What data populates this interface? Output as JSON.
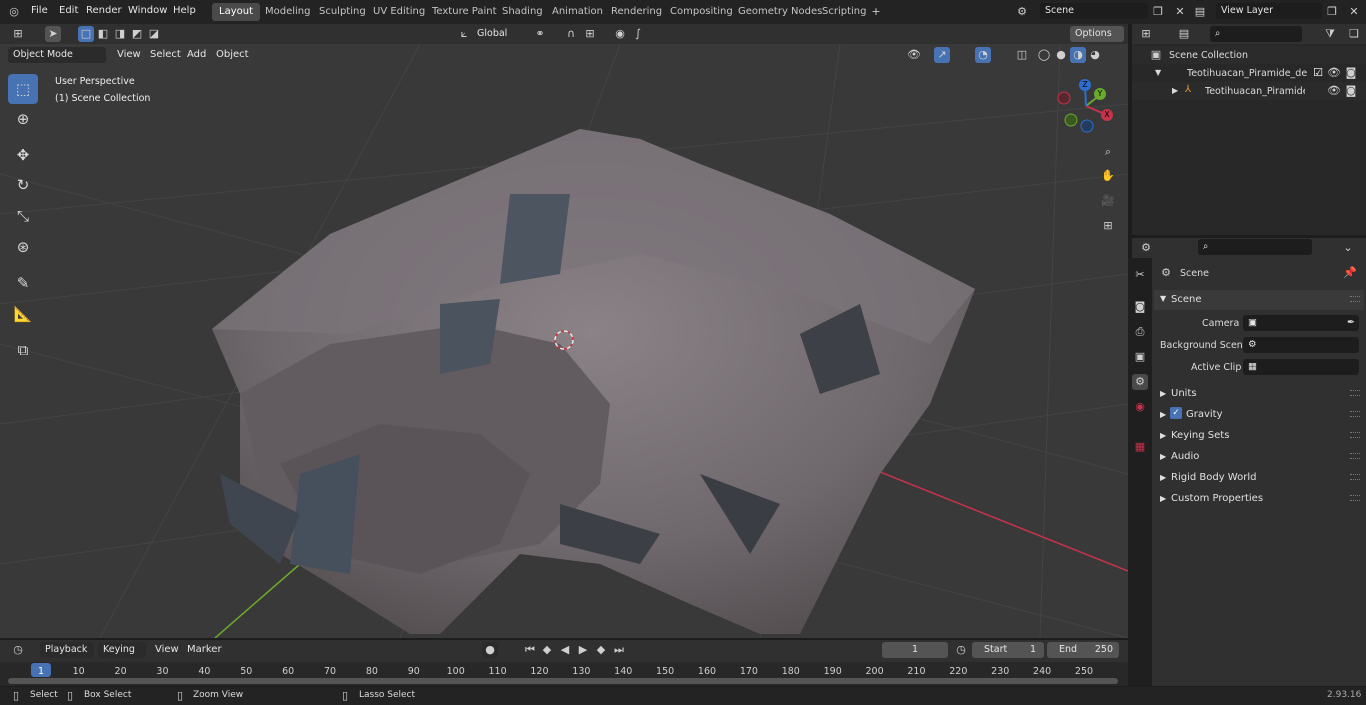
{
  "menu": [
    "File",
    "Edit",
    "Render",
    "Window",
    "Help"
  ],
  "workspaces": [
    "Layout",
    "Modeling",
    "Sculpting",
    "UV Editing",
    "Texture Paint",
    "Shading",
    "Animation",
    "Rendering",
    "Compositing",
    "Geometry Nodes",
    "Scripting"
  ],
  "scene_field": "Scene",
  "view_layer": "View Layer",
  "header": {
    "options": "Options",
    "mode": "Object Mode",
    "view": "View",
    "select": "Select",
    "add": "Add",
    "object": "Object",
    "orientation": "Global"
  },
  "viewport": {
    "perspective": "User Perspective",
    "collection": "(1) Scene Collection"
  },
  "gizmo": {
    "x": "X",
    "y": "Y",
    "z": "Z"
  },
  "outliner": {
    "root": "Scene Collection",
    "item1": "Teotihuacan_Piramide_de_la_",
    "item2": "Teotihuacan_Piramide_de"
  },
  "props": {
    "title": "Scene",
    "section": "Scene",
    "camera": "Camera",
    "bg_scene": "Background Scene",
    "active_clip": "Active Clip",
    "units": "Units",
    "gravity": "Gravity",
    "keying_sets": "Keying Sets",
    "audio": "Audio",
    "rigid": "Rigid Body World",
    "custom": "Custom Properties"
  },
  "timeline": {
    "playback": "Playback",
    "keying": "Keying",
    "view": "View",
    "marker": "Marker",
    "current_frame": "1",
    "start_label": "Start",
    "start": "1",
    "end_label": "End",
    "end": "250",
    "ticks": [
      "1",
      "10",
      "20",
      "30",
      "40",
      "50",
      "60",
      "70",
      "80",
      "90",
      "100",
      "110",
      "120",
      "130",
      "140",
      "150",
      "160",
      "170",
      "180",
      "190",
      "200",
      "210",
      "220",
      "230",
      "240",
      "250"
    ]
  },
  "status": {
    "select": "Select",
    "box_select": "Box Select",
    "zoom_view": "Zoom View",
    "lasso_select": "Lasso Select",
    "version": "2.93.16"
  },
  "colors": {
    "accent": "#4772b3",
    "x_axis": "#c7334a",
    "y_axis": "#6aaa2c",
    "z_axis": "#2d6ecf"
  }
}
